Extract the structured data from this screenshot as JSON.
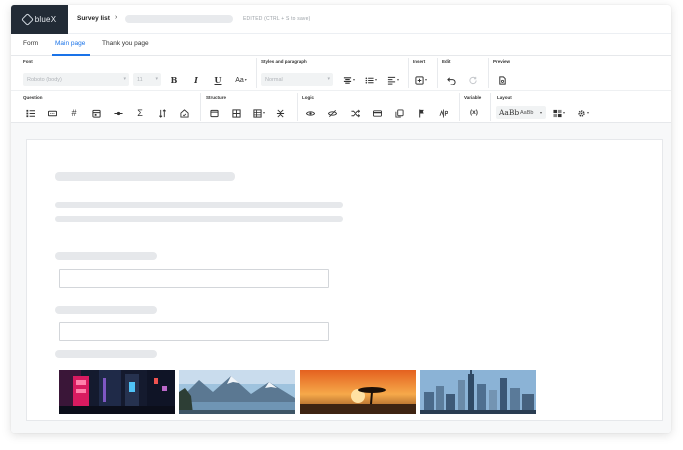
{
  "app": {
    "brand": "blueX",
    "breadcrumb": "Survey list",
    "save_hint": "EDITED (CTRL + S to save)"
  },
  "tabs": [
    {
      "label": "Form"
    },
    {
      "label": "Main page"
    },
    {
      "label": "Thank you page"
    }
  ],
  "active_tab": "Main page",
  "ribbon": {
    "groups": {
      "font": "Font",
      "styles": "Styles and paragraph",
      "insert": "Insert",
      "edit": "Edit",
      "preview": "Preview",
      "question": "Question",
      "structure": "Structure",
      "logic": "Logic",
      "variable": "Variable",
      "layout": "Layout"
    },
    "font_family": "Roboto (body)",
    "font_size": "11",
    "bold": "B",
    "italic": "I",
    "underline": "U",
    "text_size": "Aa",
    "paragraph_style": "Normal",
    "sum": "Σ",
    "variable_icon": "(x)",
    "layout_preview_large": "AaBb",
    "layout_preview_small": "AaBb"
  },
  "icons": [
    "logo-mark-icon",
    "chevron-right-icon",
    "chevron-down-icon",
    "align-center-icon",
    "bullet-list-icon",
    "numbered-list-icon",
    "insert-icon",
    "undo-icon",
    "redo-icon",
    "preview-icon",
    "list-question-icon",
    "text-input-icon",
    "number-icon",
    "date-icon",
    "slider-icon",
    "sum-icon",
    "sort-icon",
    "rating-icon",
    "page-icon",
    "grid-icon",
    "table-icon",
    "collapse-icon",
    "visible-icon",
    "hidden-icon",
    "shuffle-icon",
    "card-icon",
    "copy-icon",
    "flag-icon",
    "split-icon",
    "variable-icon",
    "palette-icon",
    "gear-icon"
  ],
  "images": [
    {
      "name": "image-neon-street"
    },
    {
      "name": "image-mountain-lake"
    },
    {
      "name": "image-savanna-sunset"
    },
    {
      "name": "image-city-skyline"
    }
  ],
  "colors": {
    "accent": "#1a73e8",
    "brand_bg": "#222b36",
    "skeleton": "#e6e8eb"
  }
}
